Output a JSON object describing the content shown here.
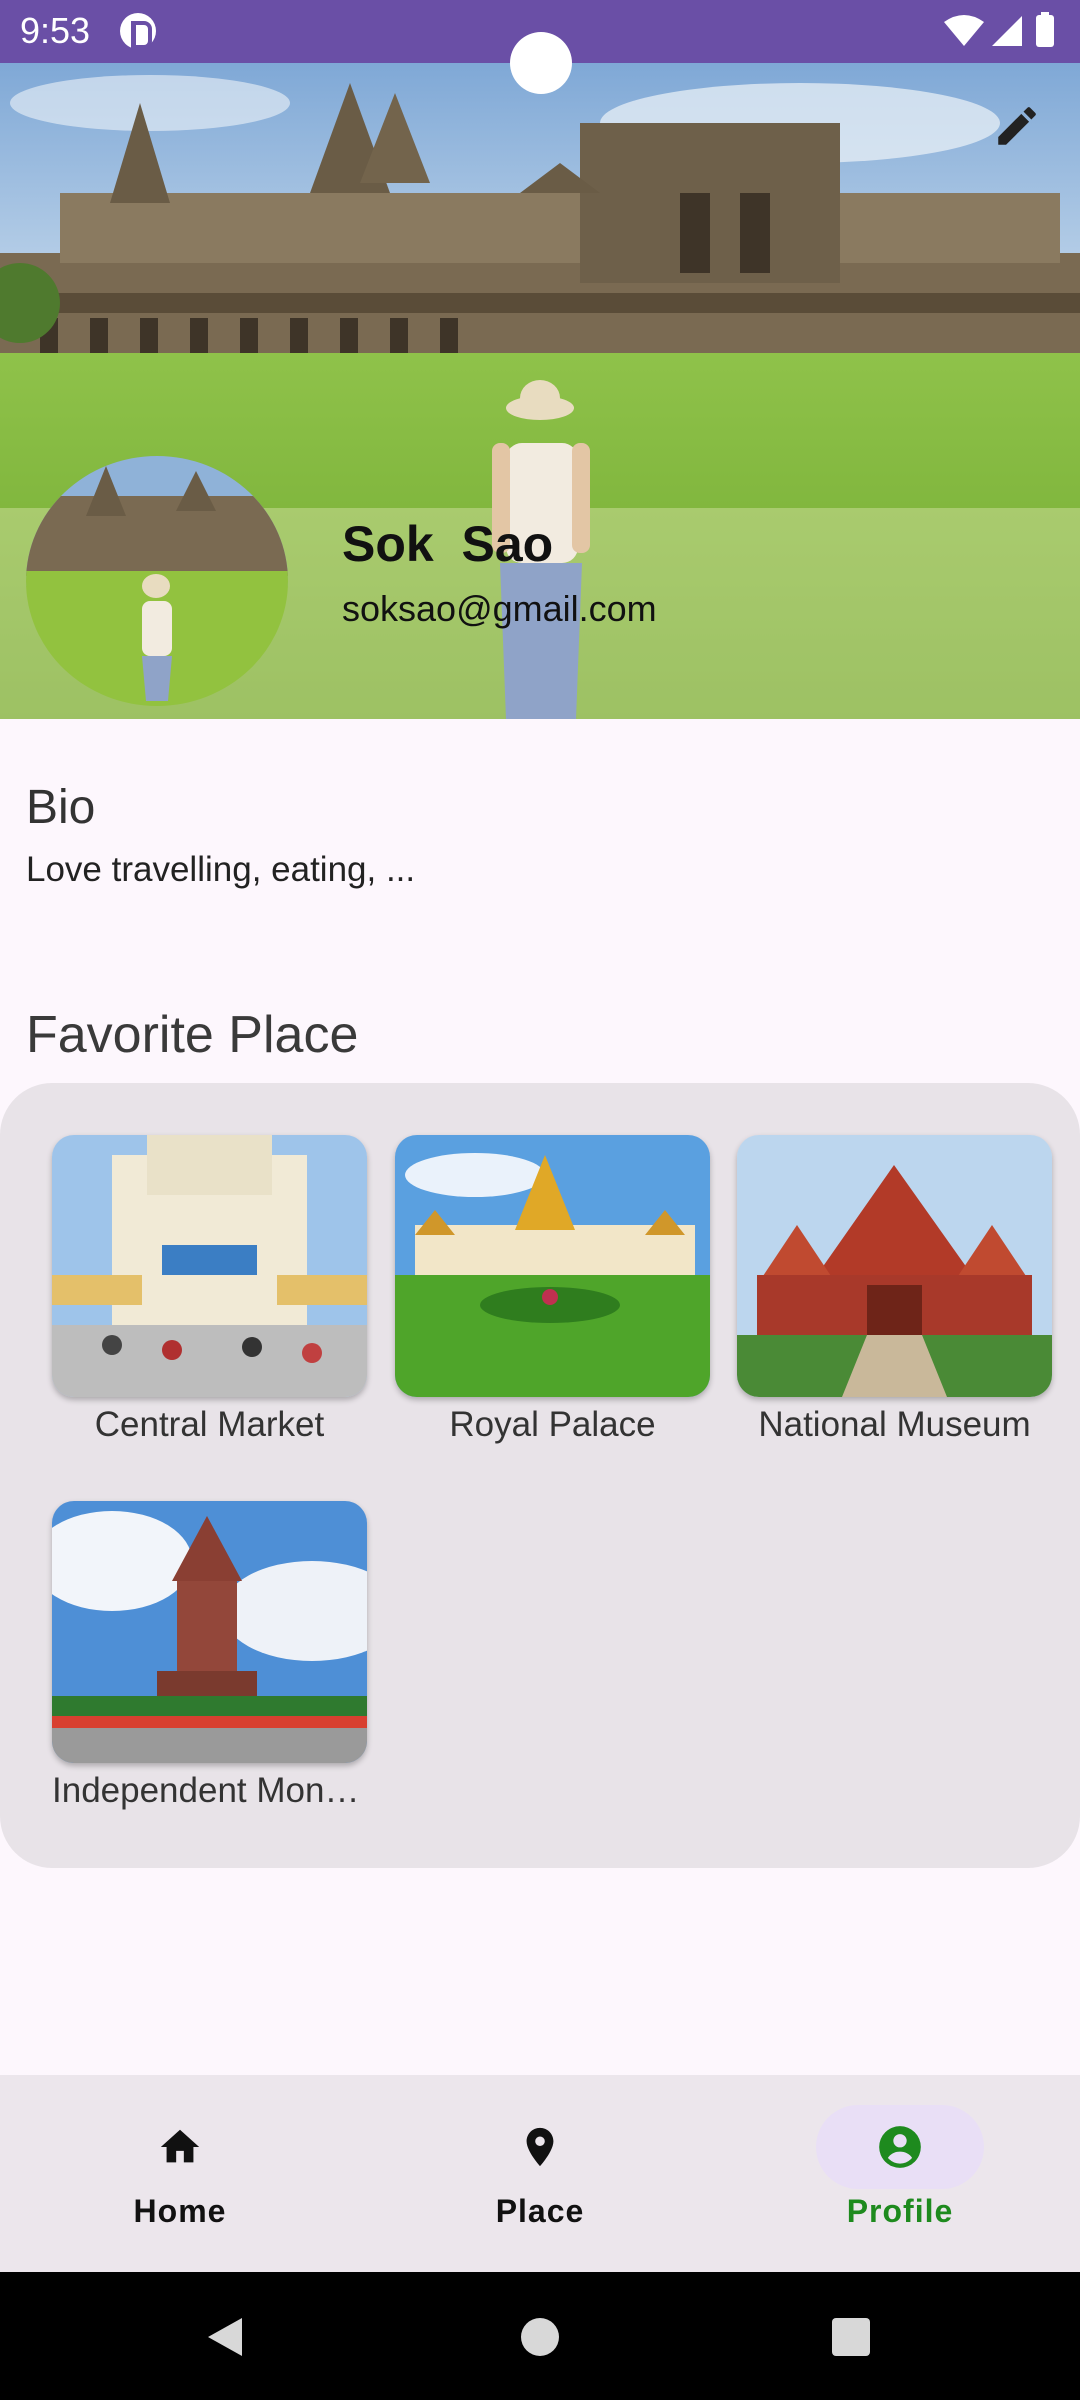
{
  "status_bar": {
    "time": "9:53",
    "icons": [
      "app-notification-icon",
      "wifi-icon",
      "signal-icon",
      "battery-icon"
    ]
  },
  "header": {
    "edit_icon": "pencil-icon",
    "name": "Sok  Sao",
    "email": "soksao@gmail.com"
  },
  "bio": {
    "title": "Bio",
    "text": "Love travelling, eating, ..."
  },
  "favorites": {
    "title": "Favorite Place",
    "places": [
      {
        "name": "Central Market"
      },
      {
        "name": "Royal Palace"
      },
      {
        "name": "National Museum"
      },
      {
        "name": "Independent Monument"
      }
    ]
  },
  "bottom_nav": {
    "items": [
      {
        "label": "Home",
        "icon": "home-icon"
      },
      {
        "label": "Place",
        "icon": "location-pin-icon"
      },
      {
        "label": "Profile",
        "icon": "account-circle-icon",
        "active": true
      }
    ],
    "active_color": "#1e8a1e"
  },
  "colors": {
    "status_bar": "#6a4fa6",
    "background": "#fdf7fd",
    "card": "#e8e3e8"
  }
}
